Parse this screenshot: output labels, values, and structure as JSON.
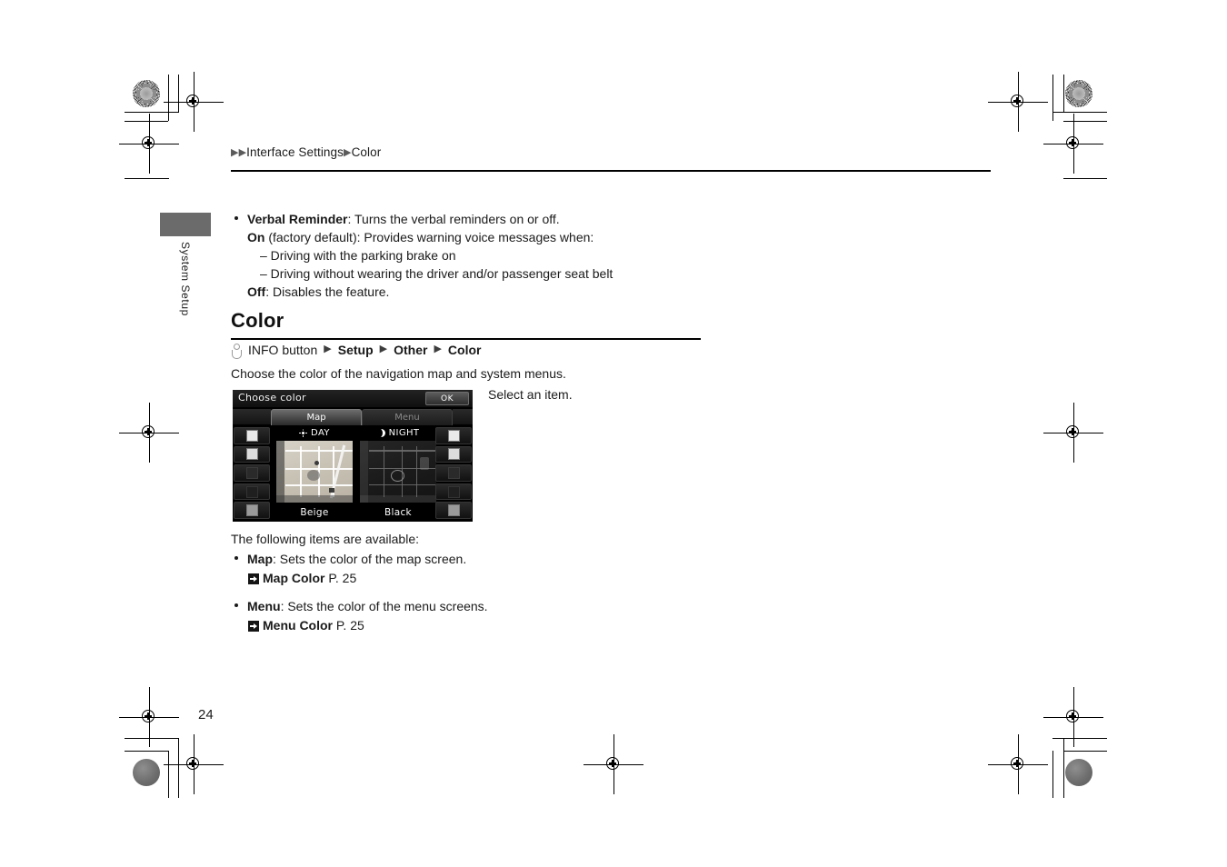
{
  "page": {
    "number": "24",
    "side_tab_label": "System Setup"
  },
  "breadcrumb": {
    "arrow": "▶",
    "segments": [
      "Interface Settings",
      "Color"
    ]
  },
  "verbal_reminder": {
    "term": "Verbal Reminder",
    "description": ": Turns the verbal reminders on or off.",
    "on_term": "On",
    "on_description": " (factory default): Provides warning voice messages when:",
    "conditions": [
      "– Driving with the parking brake on",
      "– Driving without wearing the driver and/or passenger seat belt"
    ],
    "off_term": "Off",
    "off_description": ": Disables the feature."
  },
  "section": {
    "title": "Color",
    "path_icon_name": "info-button-icon",
    "path_prefix": "INFO button",
    "path_arrow": "▶",
    "path_items": [
      "Setup",
      "Other",
      "Color"
    ],
    "intro": "Choose the color of the navigation map and system menus.",
    "caption": "Select an item.",
    "following_intro": "The following items are available:"
  },
  "nav_screen": {
    "title": "Choose color",
    "ok_label": "OK",
    "tabs": [
      {
        "label": "Map",
        "active": true
      },
      {
        "label": "Menu",
        "active": false
      }
    ],
    "panels": [
      {
        "mode": "DAY",
        "mode_icon": "sun-icon",
        "color_name": "Beige"
      },
      {
        "mode": "NIGHT",
        "mode_icon": "moon-icon",
        "color_name": "Black"
      }
    ],
    "swatch_count_per_side": 5,
    "background_color": "#000000"
  },
  "items": [
    {
      "term": "Map",
      "description": ": Sets the color of the map screen.",
      "reference_label": "Map Color",
      "reference_page": "P. 25"
    },
    {
      "term": "Menu",
      "description": ": Sets the color of the menu screens.",
      "reference_label": "Menu Color",
      "reference_page": "P. 25"
    }
  ]
}
